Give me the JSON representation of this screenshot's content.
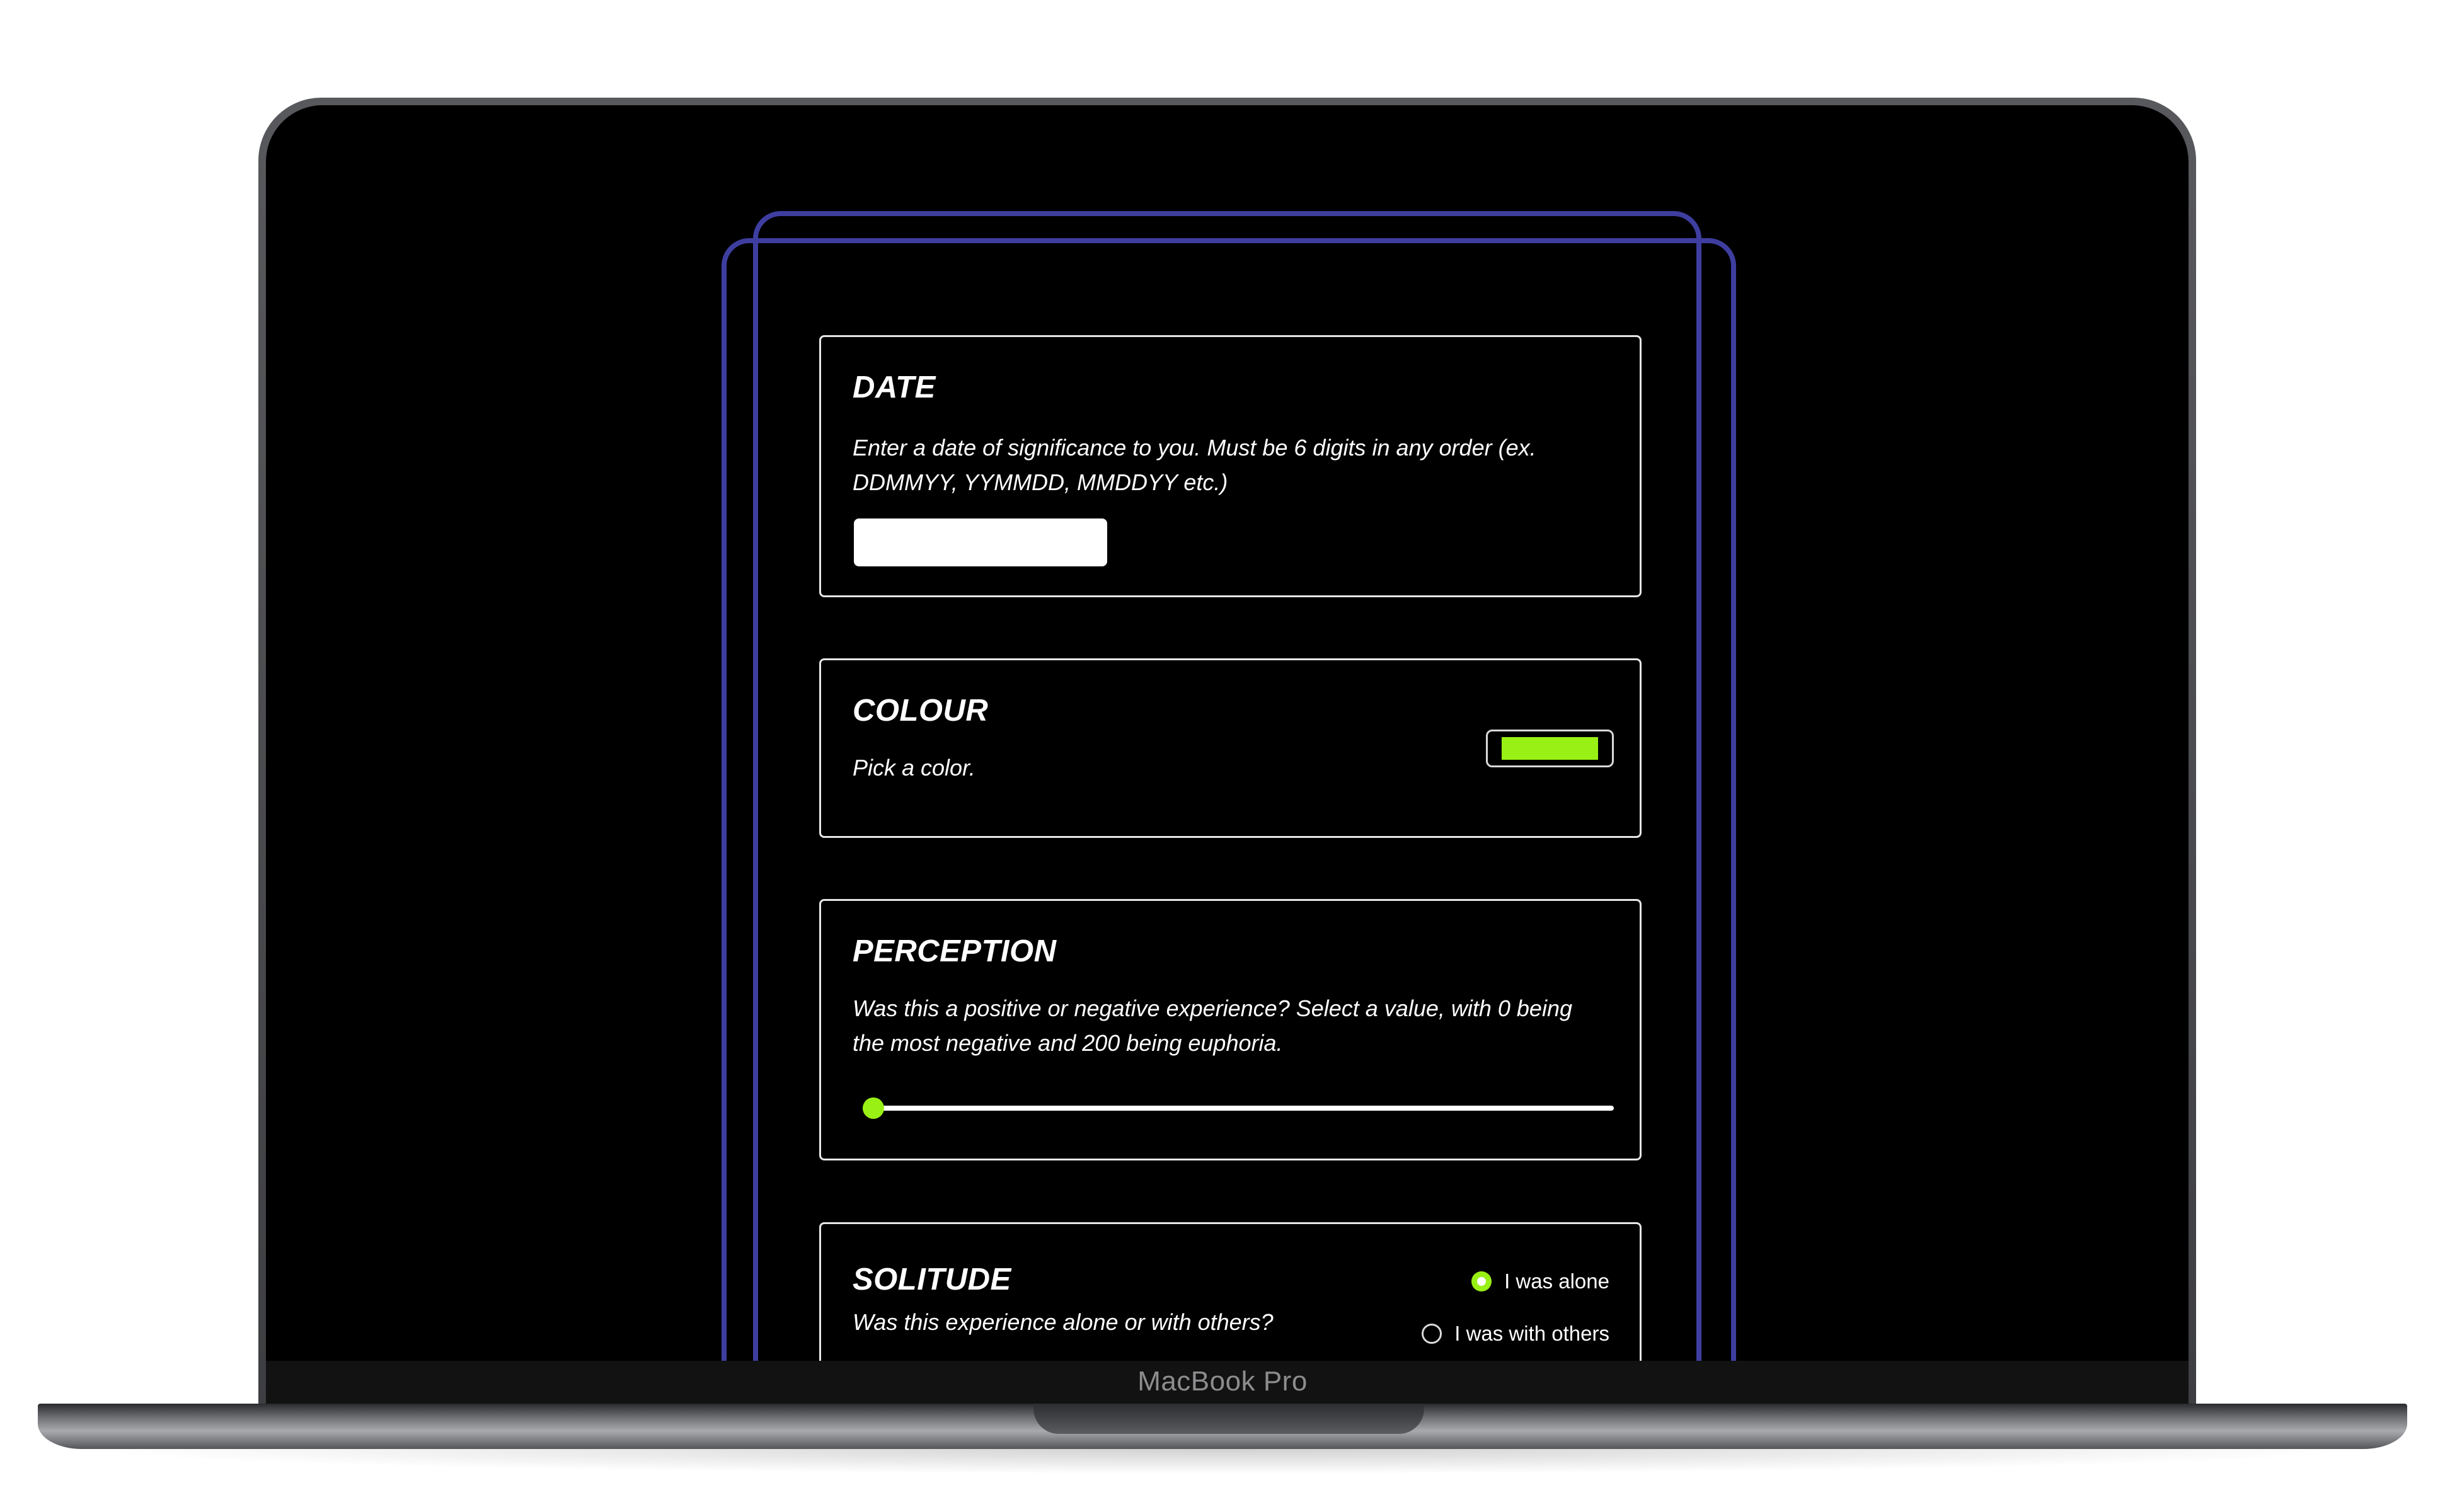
{
  "device": {
    "label": "MacBook Pro"
  },
  "theme": {
    "accent": "#99f014",
    "outline": "#3e3ea0",
    "background": "#000000"
  },
  "form": {
    "date": {
      "title": "DATE",
      "description": "Enter a date of significance to you. Must be 6 digits in any order (ex. DDMMYY, YYMMDD, MMDDYY etc.)",
      "value": ""
    },
    "colour": {
      "title": "COLOUR",
      "description": "Pick a color.",
      "value": "#99f014"
    },
    "perception": {
      "title": "PERCEPTION",
      "description": "Was this a positive or negative experience? Select a value, with 0 being the most negative and 200 being euphoria.",
      "min": 0,
      "max": 200,
      "value": 0
    },
    "solitude": {
      "title": "SOLITUDE",
      "description": "Was this experience alone or with others?",
      "options": [
        {
          "label": "I was alone",
          "selected": true
        },
        {
          "label": "I was with others",
          "selected": false
        }
      ]
    }
  }
}
